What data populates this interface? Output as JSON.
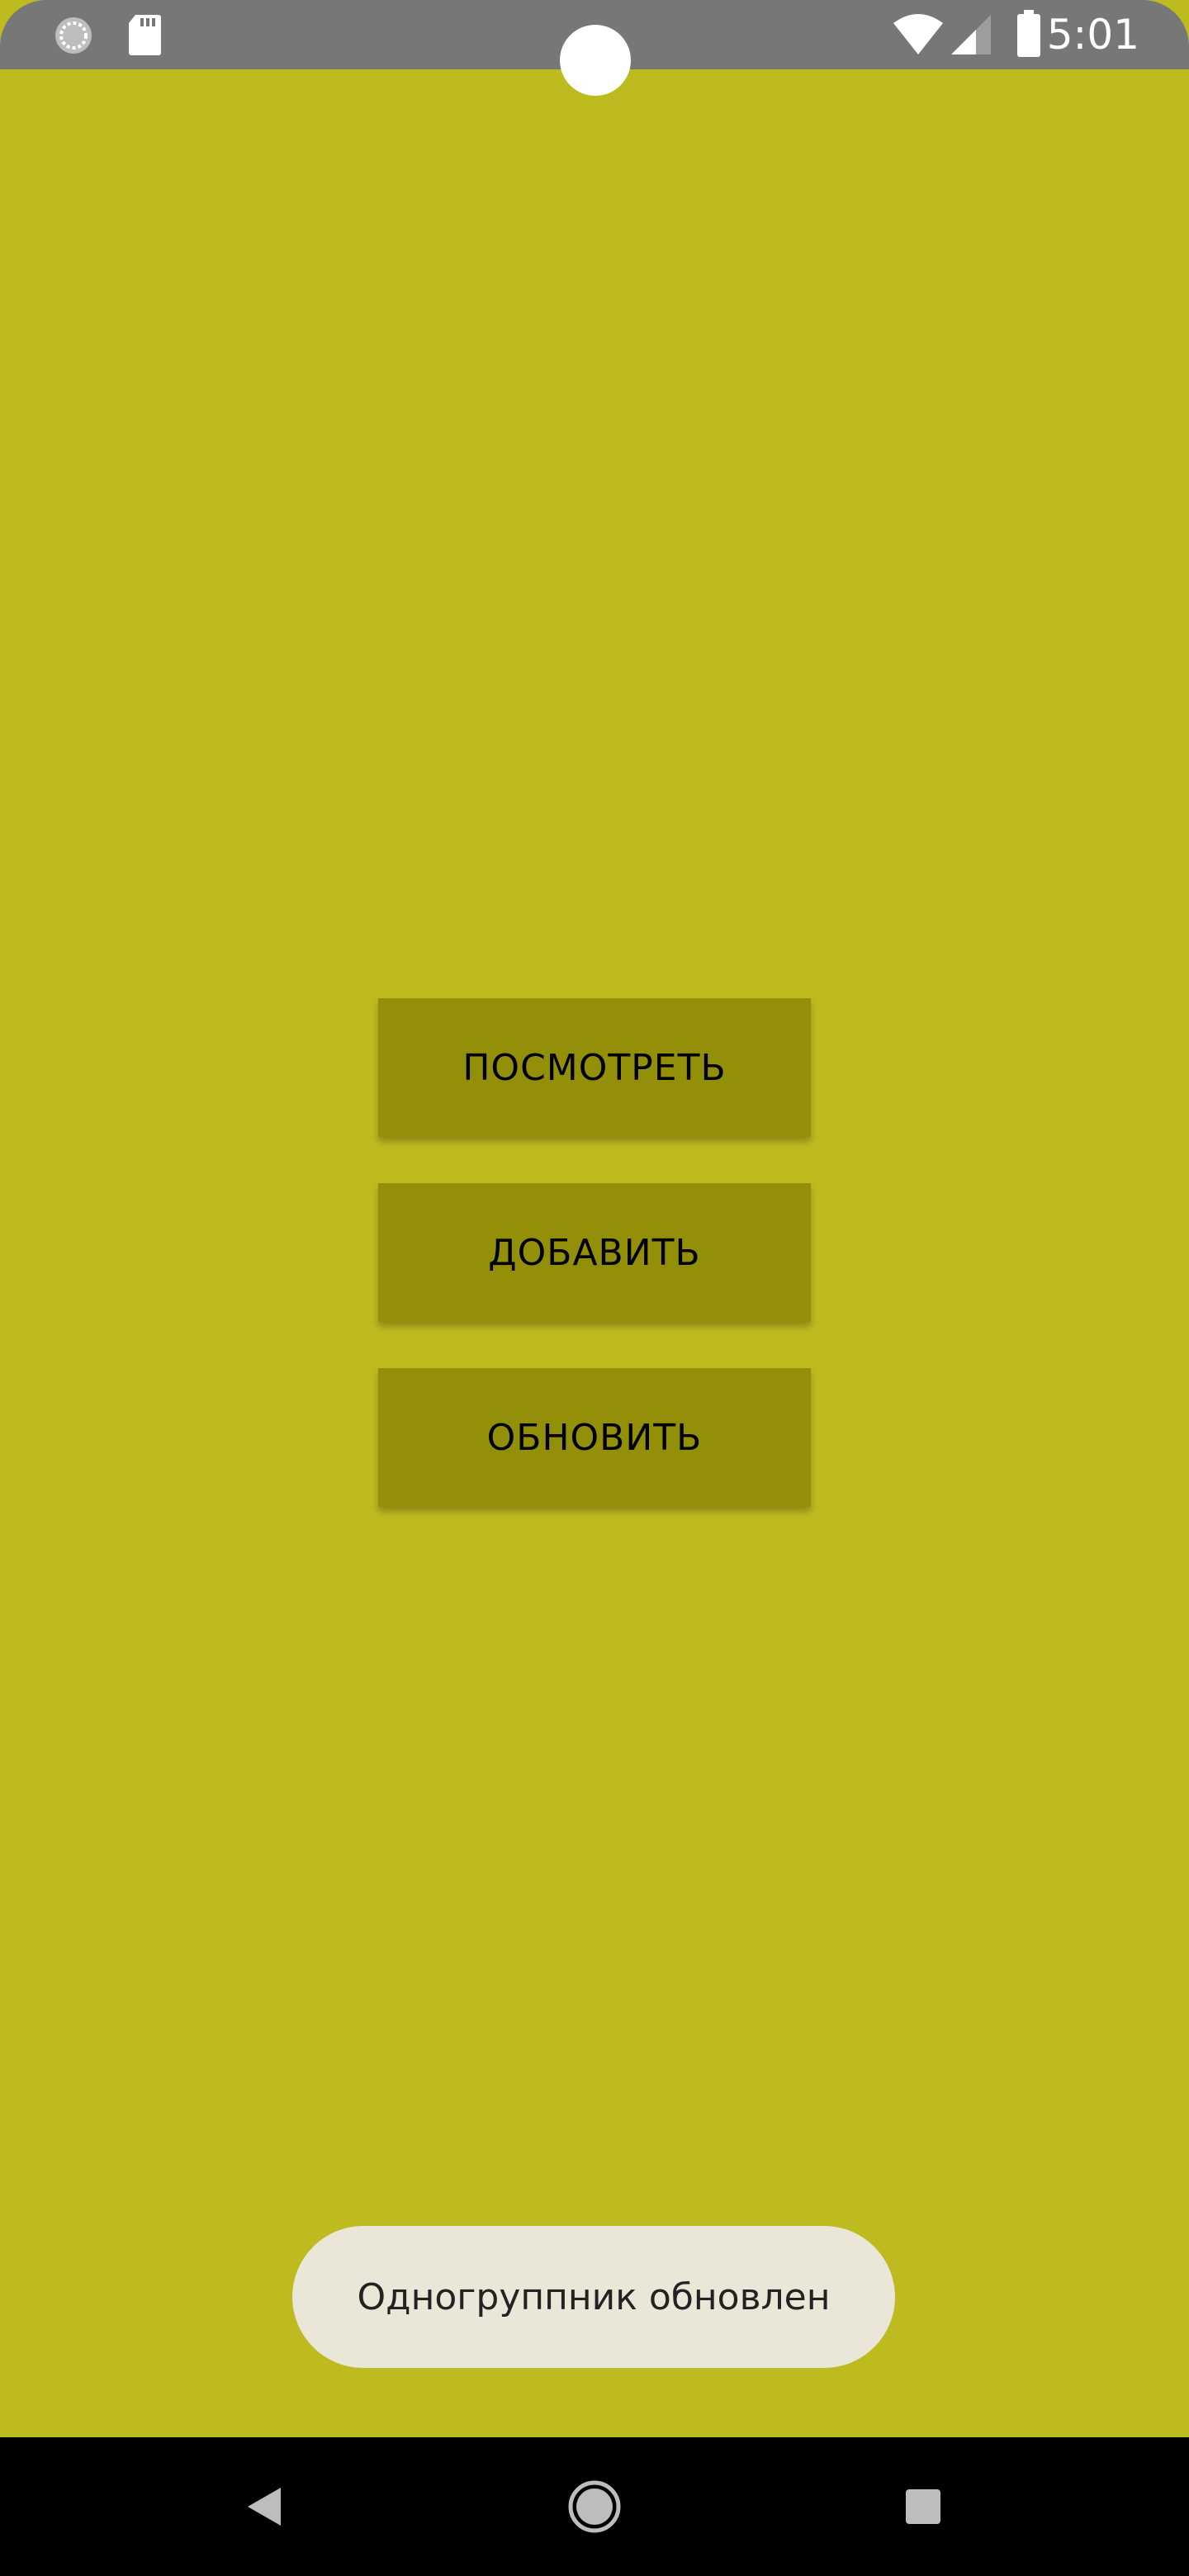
{
  "status_bar": {
    "time": "5:01",
    "icons": [
      "sync-icon",
      "sd-card-icon",
      "wifi-icon",
      "signal-icon",
      "battery-icon"
    ]
  },
  "buttons": {
    "view_label": "ПОСМОТРЕТЬ",
    "add_label": "ДОБАВИТЬ",
    "update_label": "ОБНОВИТЬ"
  },
  "toast": {
    "message": "Одногруппник обновлен"
  },
  "nav_bar": {
    "icons": [
      "back-icon",
      "home-icon",
      "recents-icon"
    ]
  },
  "colors": {
    "background": "#bebb21",
    "button": "#938f09",
    "status_bar": "#777777",
    "toast": "#eae7d9",
    "nav_bar": "#000000"
  }
}
